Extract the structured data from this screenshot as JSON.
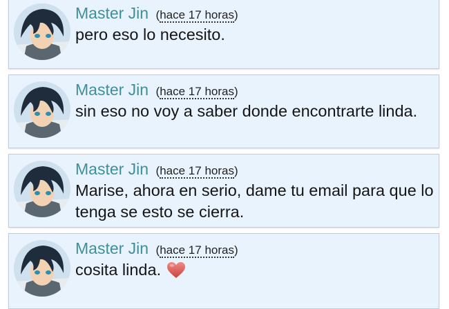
{
  "comments": [
    {
      "author": "Master Jin",
      "time": "hace 17 horas",
      "text": "pero eso lo necesito."
    },
    {
      "author": "Master Jin",
      "time": "hace 17 horas",
      "text": "sin eso no voy a saber donde encontrarte linda."
    },
    {
      "author": "Master Jin",
      "time": "hace 17 horas",
      "text": "Marise, ahora en serio, dame tu email para que lo tenga se esto se cierra."
    },
    {
      "author": "Master Jin",
      "time": "hace 17 horas",
      "text": "cosita linda.",
      "emoji": "heart-icon"
    }
  ],
  "colors": {
    "card_background": "#e9f3fe",
    "author_name": "#3f8f99",
    "heart": "#d9534f"
  }
}
